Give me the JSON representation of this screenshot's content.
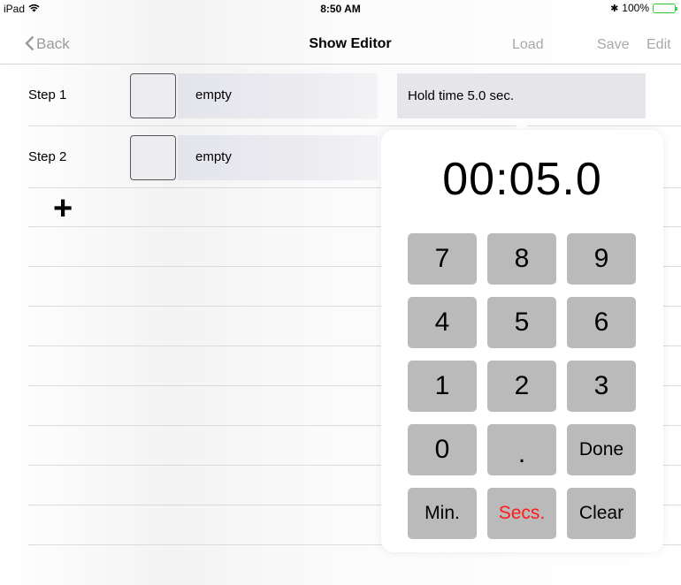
{
  "status_bar": {
    "device": "iPad",
    "time": "8:50 AM",
    "bluetooth": "✱",
    "battery": "100%",
    "battery_level": 1.0,
    "battery_color": "#31d64a"
  },
  "nav": {
    "back_label": "Back",
    "title": "Show Editor",
    "load_label": "Load",
    "save_label": "Save",
    "edit_label": "Edit"
  },
  "steps": [
    {
      "label": "Step 1",
      "content": "empty",
      "hold": "Hold time 5.0 sec."
    },
    {
      "label": "Step 2",
      "content": "empty"
    }
  ],
  "add_step_label": "+",
  "timer_popover": {
    "display": "00:05.0",
    "keys": {
      "k7": "7",
      "k8": "8",
      "k9": "9",
      "k4": "4",
      "k5": "5",
      "k6": "6",
      "k1": "1",
      "k2": "2",
      "k3": "3",
      "k0": "0",
      "dot": ".",
      "done": "Done",
      "min": "Min.",
      "secs": "Secs.",
      "clear": "Clear"
    },
    "selected_unit_color": "#ff1a1a"
  }
}
